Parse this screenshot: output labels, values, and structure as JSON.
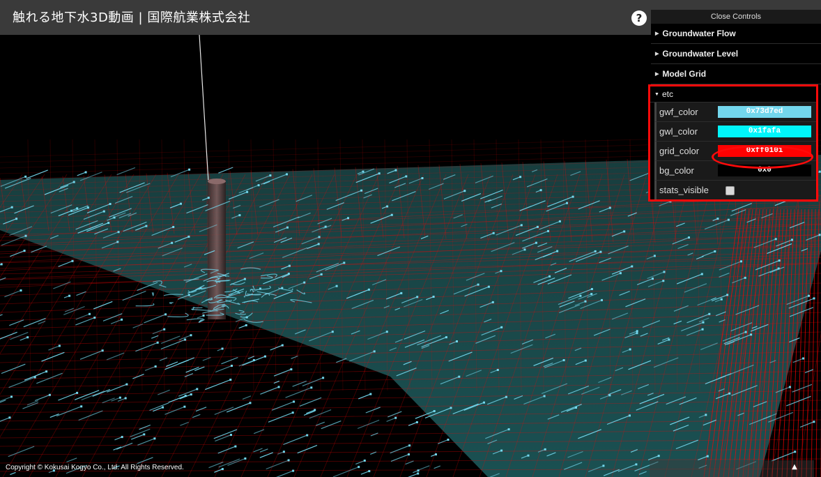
{
  "header": {
    "title": "触れる地下水3D動画 | 国際航業株式会社",
    "help_label": "?"
  },
  "gui": {
    "close_label": "Close Controls",
    "folders": [
      {
        "label": "Groundwater Flow",
        "collapsed": true
      },
      {
        "label": "Groundwater Level",
        "collapsed": true
      },
      {
        "label": "Model Grid",
        "collapsed": true
      }
    ],
    "etc": {
      "label": "etc",
      "expanded": true,
      "props": [
        {
          "label": "gwf_color",
          "value": "0x73d7ed",
          "swatch": "#73d7ed"
        },
        {
          "label": "gwl_color",
          "value": "0x1fafa",
          "swatch": "#00f5fa"
        },
        {
          "label": "grid_color",
          "value": "0xff0101",
          "swatch": "#ff0101"
        },
        {
          "label": "bg_color",
          "value": "0x0",
          "swatch": "#000000"
        }
      ],
      "stats_visible": {
        "label": "stats_visible",
        "checked": false
      }
    }
  },
  "footer": {
    "copyright": "Copyright © Kokusai Kogyo Co., Ltd. All Rights Reserved.",
    "scroll_top_icon": "▲"
  },
  "colors": {
    "grid": "#ff0101",
    "flow": "#73d7ed",
    "level": "#00f5fa",
    "background": "#000000",
    "highlight": "#ff0a0a"
  }
}
